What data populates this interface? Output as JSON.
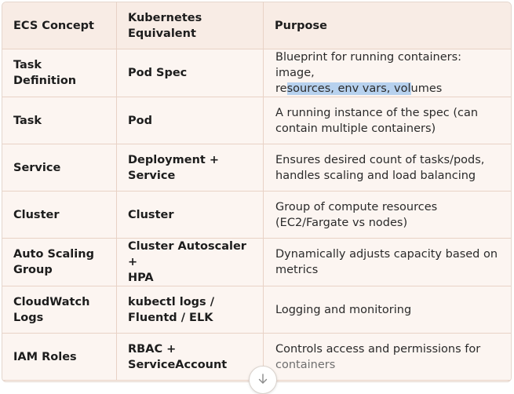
{
  "table": {
    "headers": [
      "ECS Concept",
      "Kubernetes Equivalent",
      "Purpose"
    ],
    "header_lines": {
      "col1": [
        "ECS Concept"
      ],
      "col2": [
        "Kubernetes",
        "Equivalent"
      ],
      "col3": [
        "Purpose"
      ]
    },
    "rows": [
      {
        "ecs": [
          "Task Definition"
        ],
        "k8s": [
          "Pod Spec"
        ],
        "purpose_line1": "Blueprint for running containers: image,",
        "purpose_line2_pre": "re",
        "purpose_line2_hl": "sources, env vars, vol",
        "purpose_line2_post": "umes"
      },
      {
        "ecs": [
          "Task"
        ],
        "k8s": [
          "Pod"
        ],
        "purpose": [
          "A running instance of the spec (can",
          "contain multiple containers)"
        ]
      },
      {
        "ecs": [
          "Service"
        ],
        "k8s": [
          "Deployment +",
          "Service"
        ],
        "purpose": [
          "Ensures desired count of tasks/pods,",
          "handles scaling and load balancing"
        ]
      },
      {
        "ecs": [
          "Cluster"
        ],
        "k8s": [
          "Cluster"
        ],
        "purpose": [
          "Group of compute resources",
          "(EC2/Fargate vs nodes)"
        ]
      },
      {
        "ecs": [
          "Auto Scaling",
          "Group"
        ],
        "k8s": [
          "Cluster Autoscaler +",
          "HPA"
        ],
        "purpose": [
          "Dynamically adjusts capacity based on",
          "metrics"
        ]
      },
      {
        "ecs": [
          "CloudWatch",
          "Logs"
        ],
        "k8s": [
          "kubectl logs /",
          "Fluentd / ELK"
        ],
        "purpose": [
          "Logging and monitoring"
        ]
      },
      {
        "ecs": [
          "IAM Roles"
        ],
        "k8s": [
          "RBAC +",
          "ServiceAccount"
        ],
        "purpose": [
          "Controls access and permissions for",
          "containers"
        ]
      }
    ]
  },
  "scroll_button": {
    "icon": "arrow-down-icon"
  },
  "colors": {
    "highlight": "#b7d1ee",
    "row_bg": "#fcf5f1",
    "header_bg": "#f8ece5",
    "border": "#e8d2c6"
  }
}
